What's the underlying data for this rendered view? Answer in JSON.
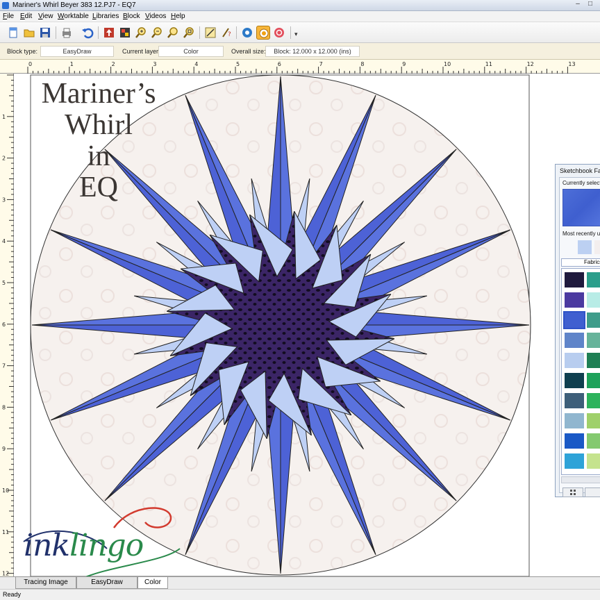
{
  "window": {
    "title": "Mariner's Whirl Beyer 383 12.PJ7 - EQ7"
  },
  "menu": [
    {
      "accel": "F",
      "rest": "ile"
    },
    {
      "accel": "E",
      "rest": "dit"
    },
    {
      "accel": "V",
      "rest": "iew"
    },
    {
      "accel": "W",
      "rest": "orktable"
    },
    {
      "accel": "L",
      "rest": "ibraries"
    },
    {
      "accel": "B",
      "rest": "lock"
    },
    {
      "accel": "V",
      "rest": "ideos"
    },
    {
      "accel": "H",
      "rest": "elp"
    }
  ],
  "toolbar": {
    "icons": [
      "new-icon",
      "open-icon",
      "save-icon",
      "print-icon",
      "undo-icon",
      "add-to-sketchbook-icon",
      "view-sketchbook-icon",
      "zoom-in-icon",
      "zoom-out-icon",
      "fit-to-worktable-icon",
      "refresh-icon",
      "pick-icon",
      "precision-icon",
      "camera-icon",
      "paintbrush-icon",
      "spraycan-icon"
    ]
  },
  "infobar": {
    "block_type_label": "Block type:",
    "block_type_value": "EasyDraw",
    "current_layer_label": "Current layer:",
    "current_layer_value": "Color",
    "overall_size_label": "Overall size:",
    "overall_size_value": "Block: 12.000 x 12.000 (ins)"
  },
  "rulers": {
    "horizontal": [
      "0",
      "1",
      "2",
      "3",
      "4",
      "5",
      "6",
      "7",
      "8",
      "9",
      "10",
      "11",
      "12",
      "13"
    ],
    "vertical": [
      "1",
      "2",
      "3",
      "4",
      "5",
      "6",
      "7",
      "8",
      "9",
      "10",
      "11",
      "12"
    ]
  },
  "overlay": {
    "title_lines": [
      "Mariner’s",
      "Whirl",
      "in",
      "EQ"
    ],
    "logo_ink": "ink",
    "logo_lingo": "lingo"
  },
  "palette": {
    "title": "Sketchbook Fabrics",
    "currently_selected_label": "Currently selected",
    "most_recent_label": "Most recently used",
    "tab_label": "Fabrics"
  },
  "colors": {
    "background_fabric": "#f6f0ec",
    "ray_medium_blue": "#4d62d6",
    "ray_light_blue": "#bed0f5",
    "center_dark": "#2b1a4e",
    "accent_green": "#2a8a4b",
    "accent_red": "#d23a2e"
  },
  "tabs": [
    "Tracing Image",
    "EasyDraw",
    "Color"
  ],
  "active_tab": "Color",
  "status": "Ready"
}
